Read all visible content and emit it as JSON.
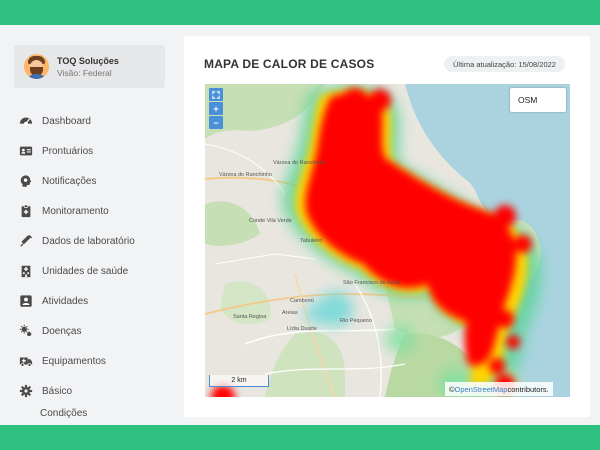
{
  "user": {
    "name": "TOQ Soluções",
    "role": "Visão: Federal"
  },
  "menu": {
    "items": [
      {
        "label": "Dashboard",
        "icon": "speedometer-icon"
      },
      {
        "label": "Prontuários",
        "icon": "id-card-icon"
      },
      {
        "label": "Notificações",
        "icon": "head-bell-icon"
      },
      {
        "label": "Monitoramento",
        "icon": "clipboard-medical-icon"
      },
      {
        "label": "Dados de laboratório",
        "icon": "syringe-icon"
      },
      {
        "label": "Unidades de saúde",
        "icon": "hospital-building-icon"
      },
      {
        "label": "Atividades",
        "icon": "person-board-icon"
      },
      {
        "label": "Doenças",
        "icon": "virus-icon"
      },
      {
        "label": "Equipamentos",
        "icon": "ambulance-icon"
      },
      {
        "label": "Básico",
        "icon": "gear-icon"
      }
    ],
    "submenu": {
      "label": "Condições"
    }
  },
  "card": {
    "title": "MAPA DE CALOR DE CASOS",
    "last_update": "Última atualização: 15/08/2022"
  },
  "map": {
    "zoom_in": "+",
    "zoom_out": "−",
    "layer_label": "OSM",
    "scale_label": "2 km",
    "attribution_prefix": "© ",
    "attribution_link": "OpenStreetMap",
    "attribution_suffix": " contributors.",
    "places": [
      "Várzea do Ranchinho",
      "Várzea do Ranchinho",
      "Conde Vila Verde",
      "Tabuleiro",
      "São Francisco de Assis",
      "Camboriú",
      "Santa Regina",
      "Areias",
      "Lídia Duarte",
      "Rio Pequeno"
    ]
  },
  "colors": {
    "brand_green": "#2fc180",
    "heat_core": "#ff0000",
    "map_accent": "#4a90d9"
  }
}
